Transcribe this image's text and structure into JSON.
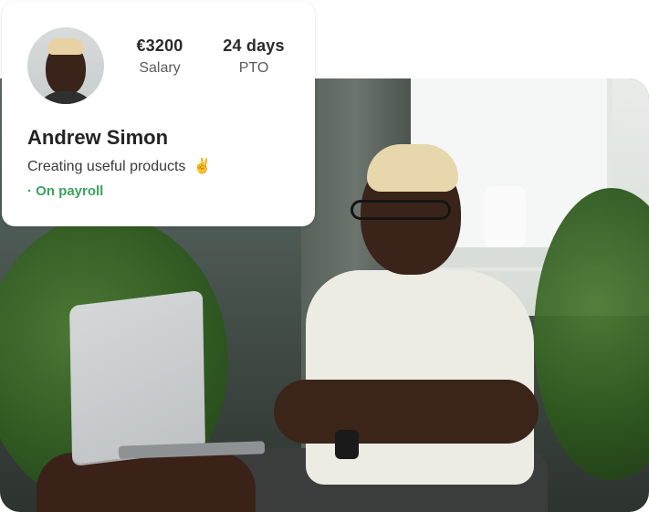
{
  "profile": {
    "salary_value": "€3200",
    "salary_label": "Salary",
    "pto_value": "24 days",
    "pto_label": "PTO",
    "name": "Andrew Simon",
    "bio": "Creating useful products",
    "bio_emoji": "✌",
    "status": "· On payroll"
  },
  "colors": {
    "status_green": "#3aa35e",
    "card_bg": "#ffffff",
    "text_dark": "#232323"
  },
  "icons": {
    "hand_emoji": "victory-hand-icon"
  }
}
